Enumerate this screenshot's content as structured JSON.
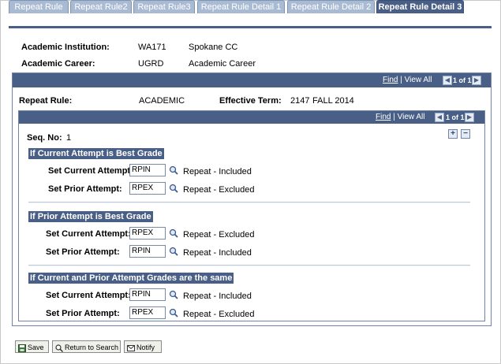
{
  "tabs": [
    {
      "label": "Repeat Rule",
      "active": false
    },
    {
      "label": "Repeat Rule2",
      "active": false
    },
    {
      "label": "Repeat Rule3",
      "active": false
    },
    {
      "label": "Repeat Rule Detail 1",
      "active": false
    },
    {
      "label": "Repeat Rule Detail 2",
      "active": false
    },
    {
      "label": "Repeat Rule Detail 3",
      "active": true
    }
  ],
  "header": {
    "institution_label": "Academic Institution:",
    "institution_code": "WA171",
    "institution_name": "Spokane CC",
    "career_label": "Academic Career:",
    "career_code": "UGRD",
    "career_name": "Academic Career"
  },
  "outer_nav": {
    "find": "Find",
    "view_all": "| View All",
    "count": "1 of 1"
  },
  "rule": {
    "repeat_rule_label": "Repeat Rule:",
    "repeat_rule_value": "ACADEMIC",
    "effective_term_label": "Effective Term:",
    "effective_term_code": "2147",
    "effective_term_name": "FALL 2014"
  },
  "inner_nav": {
    "find": "Find",
    "view_all": "| View All",
    "count": "1 of 1"
  },
  "seq": {
    "label": "Seq. No:",
    "value": "1"
  },
  "sections": [
    {
      "title": "If Current Attempt is Best Grade",
      "current_label": "Set Current Attempt:",
      "current_value": "RPIN",
      "current_desc": "Repeat - Included",
      "prior_label": "Set Prior Attempt:",
      "prior_value": "RPEX",
      "prior_desc": "Repeat - Excluded"
    },
    {
      "title": "If Prior Attempt is Best Grade",
      "current_label": "Set Current Attempt:",
      "current_value": "RPEX",
      "current_desc": "Repeat - Excluded",
      "prior_label": "Set Prior Attempt:",
      "prior_value": "RPIN",
      "prior_desc": "Repeat - Included"
    },
    {
      "title": "If Current and Prior Attempt Grades are the same",
      "current_label": "Set Current Attempt:",
      "current_value": "RPIN",
      "current_desc": "Repeat - Included",
      "prior_label": "Set Prior Attempt:",
      "prior_value": "RPEX",
      "prior_desc": "Repeat - Excluded"
    }
  ],
  "toolbar": {
    "save": "Save",
    "return_to_search": "Return to Search",
    "notify": "Notify"
  },
  "colors": {
    "tab_active": "#4a5f86",
    "tab_inactive": "#a9bbd3",
    "bar": "#4a5f86"
  }
}
